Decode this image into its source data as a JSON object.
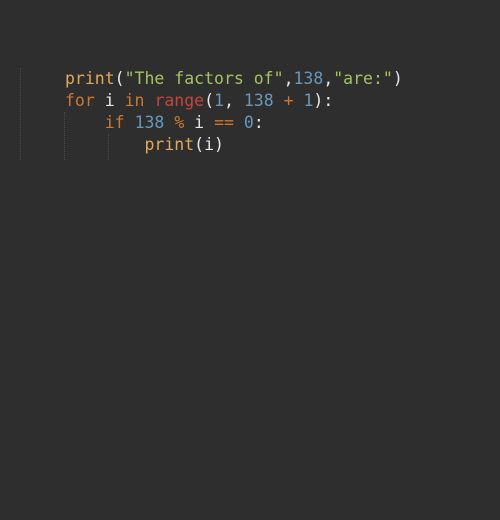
{
  "editor": {
    "background": "#2e2e2e",
    "colors": {
      "keyword": "#cc7832",
      "function": "#e2a85a",
      "builtin": "#c0463b",
      "string": "#a5c261",
      "number": "#6897bb",
      "text": "#e8e8e8"
    },
    "lines": [
      {
        "indent": "",
        "tokens": [
          {
            "type": "fn",
            "text": "print"
          },
          {
            "type": "txt",
            "text": "("
          },
          {
            "type": "str",
            "text": "\"The factors of\""
          },
          {
            "type": "txt",
            "text": ","
          },
          {
            "type": "num",
            "text": "138"
          },
          {
            "type": "txt",
            "text": ","
          },
          {
            "type": "str",
            "text": "\"are:\""
          },
          {
            "type": "txt",
            "text": ")"
          }
        ]
      },
      {
        "indent": "",
        "tokens": [
          {
            "type": "kw",
            "text": "for"
          },
          {
            "type": "txt",
            "text": " i "
          },
          {
            "type": "kw",
            "text": "in"
          },
          {
            "type": "txt",
            "text": " "
          },
          {
            "type": "bi",
            "text": "range"
          },
          {
            "type": "txt",
            "text": "("
          },
          {
            "type": "num",
            "text": "1"
          },
          {
            "type": "txt",
            "text": ", "
          },
          {
            "type": "num",
            "text": "138"
          },
          {
            "type": "txt",
            "text": " "
          },
          {
            "type": "op",
            "text": "+"
          },
          {
            "type": "txt",
            "text": " "
          },
          {
            "type": "num",
            "text": "1"
          },
          {
            "type": "txt",
            "text": "):"
          }
        ]
      },
      {
        "indent": "    ",
        "tokens": [
          {
            "type": "kw",
            "text": "if"
          },
          {
            "type": "txt",
            "text": " "
          },
          {
            "type": "num",
            "text": "138"
          },
          {
            "type": "txt",
            "text": " "
          },
          {
            "type": "op",
            "text": "%"
          },
          {
            "type": "txt",
            "text": " i "
          },
          {
            "type": "op",
            "text": "=="
          },
          {
            "type": "txt",
            "text": " "
          },
          {
            "type": "num",
            "text": "0"
          },
          {
            "type": "txt",
            "text": ":"
          }
        ]
      },
      {
        "indent": "        ",
        "tokens": [
          {
            "type": "fn",
            "text": "print"
          },
          {
            "type": "txt",
            "text": "(i)"
          }
        ]
      }
    ]
  }
}
